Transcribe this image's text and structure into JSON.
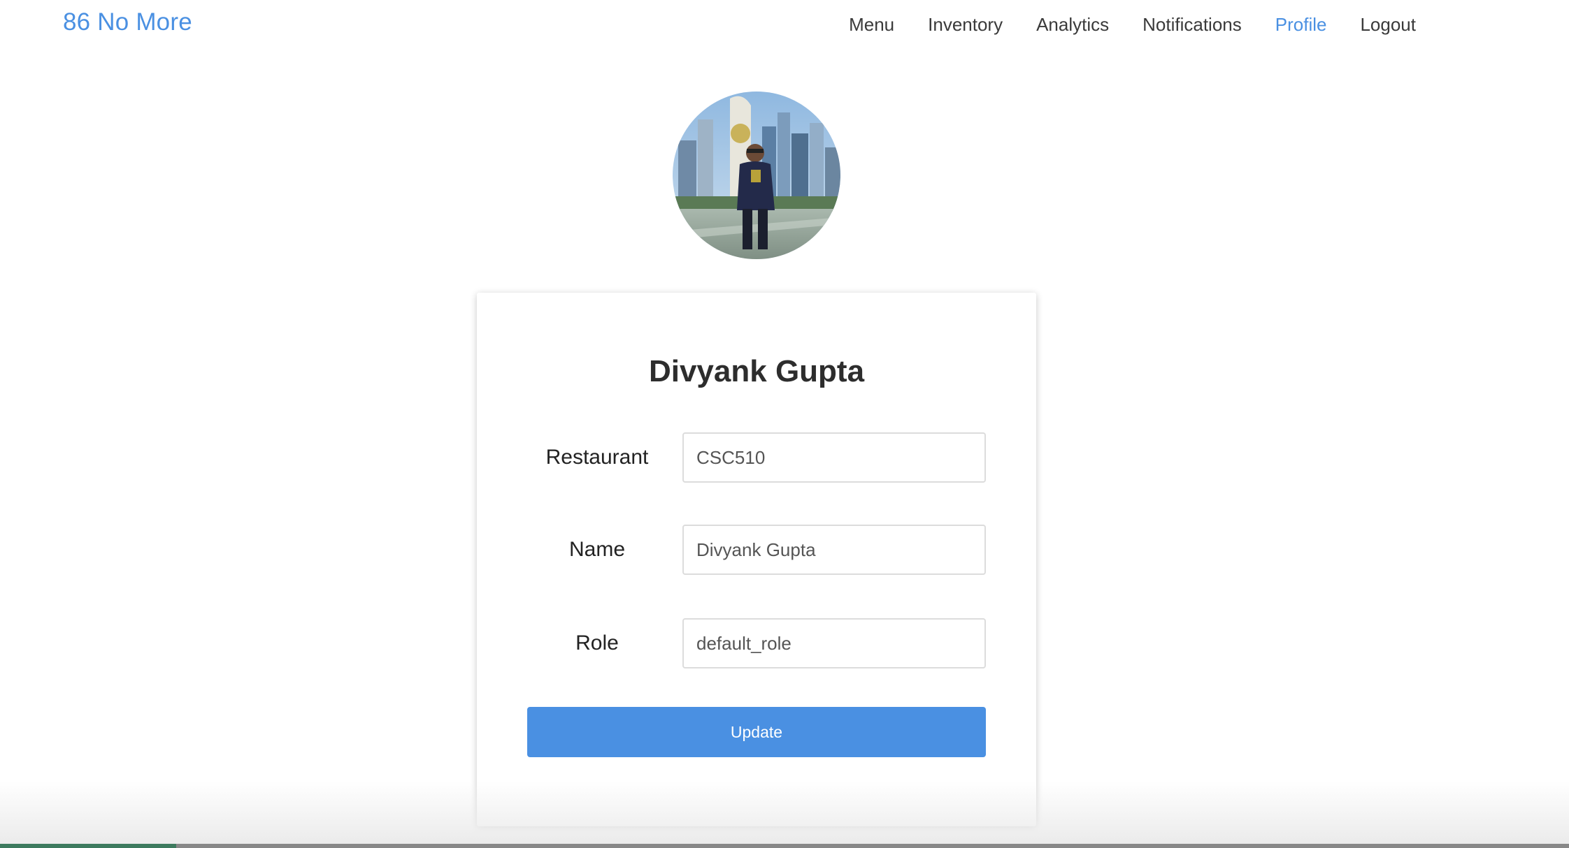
{
  "brand": {
    "title": "86 No More",
    "color": "#4a90e2"
  },
  "nav": {
    "items": [
      {
        "label": "Menu",
        "active": false
      },
      {
        "label": "Inventory",
        "active": false
      },
      {
        "label": "Analytics",
        "active": false
      },
      {
        "label": "Notifications",
        "active": false
      },
      {
        "label": "Profile",
        "active": true
      },
      {
        "label": "Logout",
        "active": false
      }
    ],
    "active_color": "#4a90e2"
  },
  "profile": {
    "avatar_icon": "user-photo-avatar",
    "name": "Divyank Gupta",
    "fields": {
      "restaurant": {
        "label": "Restaurant",
        "value": "CSC510"
      },
      "name": {
        "label": "Name",
        "value": "Divyank Gupta"
      },
      "role": {
        "label": "Role",
        "value": "default_role"
      }
    },
    "update_label": "Update",
    "button_color": "#4a90e2"
  }
}
